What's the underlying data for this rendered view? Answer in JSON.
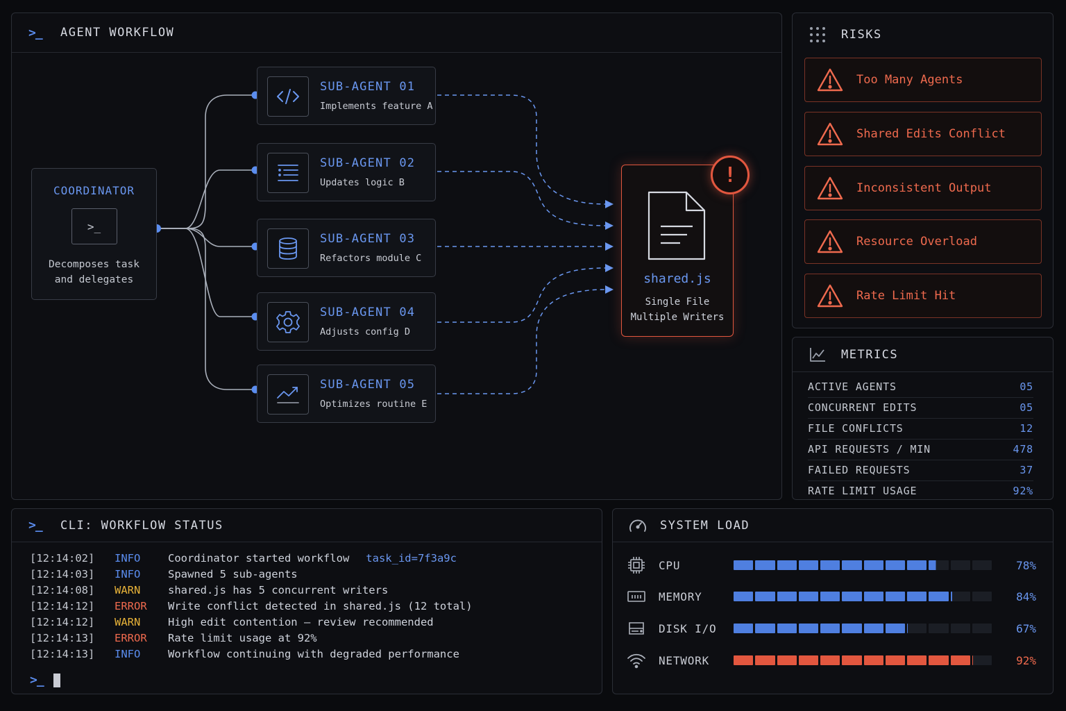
{
  "workflow": {
    "title": "AGENT WORKFLOW",
    "coordinator": {
      "title": "COORDINATOR",
      "desc_line1": "Decomposes task",
      "desc_line2": "and delegates"
    },
    "agents": [
      {
        "title": "SUB-AGENT 01",
        "desc": "Implements feature A",
        "icon": "code-icon"
      },
      {
        "title": "SUB-AGENT 02",
        "desc": "Updates logic B",
        "icon": "list-icon"
      },
      {
        "title": "SUB-AGENT 03",
        "desc": "Refactors module C",
        "icon": "database-icon"
      },
      {
        "title": "SUB-AGENT 04",
        "desc": "Adjusts config D",
        "icon": "gear-icon"
      },
      {
        "title": "SUB-AGENT 05",
        "desc": "Optimizes routine E",
        "icon": "trend-icon"
      }
    ],
    "shared_file": {
      "name": "shared.js",
      "desc_line1": "Single File",
      "desc_line2": "Multiple Writers",
      "alert": "!"
    }
  },
  "risks": {
    "title": "RISKS",
    "items": [
      {
        "label": "Too Many Agents"
      },
      {
        "label": "Shared Edits Conflict"
      },
      {
        "label": "Inconsistent Output"
      },
      {
        "label": "Resource Overload"
      },
      {
        "label": "Rate Limit Hit"
      }
    ]
  },
  "metrics": {
    "title": "METRICS",
    "rows": [
      {
        "label": "ACTIVE AGENTS",
        "value": "05"
      },
      {
        "label": "CONCURRENT EDITS",
        "value": "05"
      },
      {
        "label": "FILE CONFLICTS",
        "value": "12"
      },
      {
        "label": "API REQUESTS / MIN",
        "value": "478"
      },
      {
        "label": "FAILED REQUESTS",
        "value": "37"
      },
      {
        "label": "RATE LIMIT USAGE",
        "value": "92%"
      }
    ]
  },
  "cli": {
    "title": "CLI: WORKFLOW STATUS",
    "prompt": ">_",
    "logs": [
      {
        "time": "[12:14:02]",
        "level": "INFO",
        "msg": "Coordinator started workflow",
        "extra": "task_id=7f3a9c"
      },
      {
        "time": "[12:14:03]",
        "level": "INFO",
        "msg": "Spawned 5 sub-agents",
        "extra": ""
      },
      {
        "time": "[12:14:08]",
        "level": "WARN",
        "msg": "shared.js has 5 concurrent writers",
        "extra": ""
      },
      {
        "time": "[12:14:12]",
        "level": "ERROR",
        "msg": "Write conflict detected in shared.js (12 total)",
        "extra": ""
      },
      {
        "time": "[12:14:12]",
        "level": "WARN",
        "msg": "High edit contention – review recommended",
        "extra": ""
      },
      {
        "time": "[12:14:13]",
        "level": "ERROR",
        "msg": "Rate limit usage at 92%",
        "extra": ""
      },
      {
        "time": "[12:14:13]",
        "level": "INFO",
        "msg": "Workflow continuing with degraded performance",
        "extra": ""
      }
    ]
  },
  "system_load": {
    "title": "SYSTEM LOAD",
    "rows": [
      {
        "label": "CPU",
        "value": "78%",
        "fraction": 0.78,
        "color": "#4f7fe0",
        "icon": "cpu-icon"
      },
      {
        "label": "MEMORY",
        "value": "84%",
        "fraction": 0.84,
        "color": "#4f7fe0",
        "icon": "memory-icon"
      },
      {
        "label": "DISK I/O",
        "value": "67%",
        "fraction": 0.67,
        "color": "#4f7fe0",
        "icon": "disk-icon"
      },
      {
        "label": "NETWORK",
        "value": "92%",
        "fraction": 0.92,
        "color": "#e2573f",
        "icon": "wifi-icon"
      }
    ]
  },
  "colors": {
    "accent": "#5b8def",
    "danger": "#e2573f",
    "warn": "#e8b339"
  }
}
